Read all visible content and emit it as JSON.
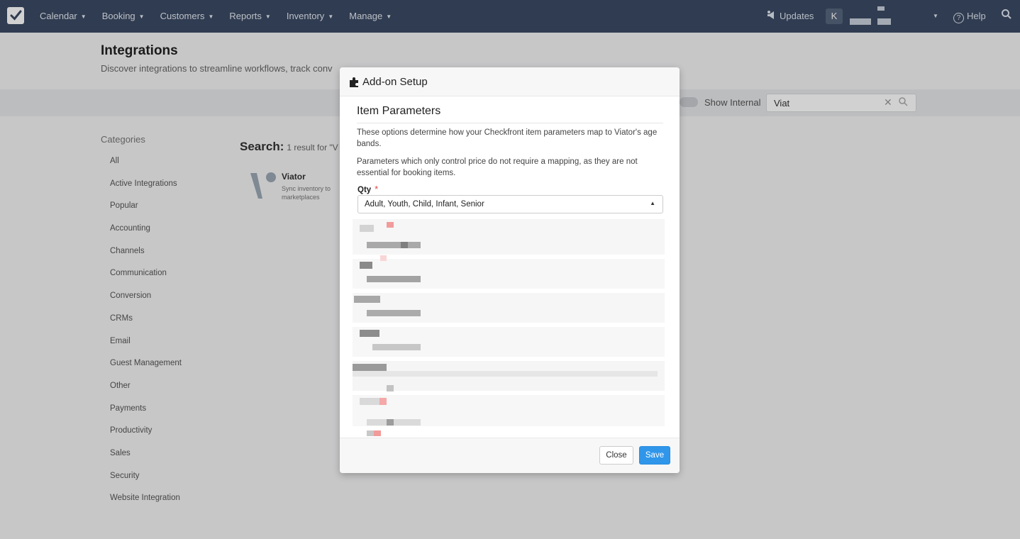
{
  "nav": {
    "menu": [
      {
        "label": "Calendar",
        "name": "calendar"
      },
      {
        "label": "Booking",
        "name": "booking"
      },
      {
        "label": "Customers",
        "name": "customers"
      },
      {
        "label": "Reports",
        "name": "reports"
      },
      {
        "label": "Inventory",
        "name": "inventory"
      },
      {
        "label": "Manage",
        "name": "manage"
      }
    ],
    "updates_label": "Updates",
    "user_initial": "K",
    "help_label": "Help"
  },
  "page": {
    "title": "Integrations",
    "subtitle": "Discover integrations to streamline workflows, track conv"
  },
  "filters": {
    "show_internal_label": "Show Internal",
    "search_value": "Viat"
  },
  "categories": {
    "heading": "Categories",
    "items": [
      "All",
      "Active Integrations",
      "Popular",
      "Accounting",
      "Channels",
      "Communication",
      "Conversion",
      "CRMs",
      "Email",
      "Guest Management",
      "Other",
      "Payments",
      "Productivity",
      "Sales",
      "Security",
      "Website Integration"
    ]
  },
  "results": {
    "label": "Search:",
    "count_text": "1 result for \"V",
    "item_name": "Viator",
    "item_desc": "Sync inventory to marketplaces"
  },
  "modal": {
    "title": "Add-on Setup",
    "section_title": "Item Parameters",
    "para1": "These options determine how your Checkfront item parameters map to Viator's age bands.",
    "para2": "Parameters which only control price do not require a mapping, as they are not essential for booking items.",
    "qty_label": "Qty",
    "required_mark": "*",
    "qty_value": "Adult, Youth, Child, Infant, Senior",
    "close_label": "Close",
    "save_label": "Save"
  },
  "colors": {
    "nav_bg": "#3b4a63",
    "primary": "#2f96ea",
    "required": "#e04545"
  }
}
